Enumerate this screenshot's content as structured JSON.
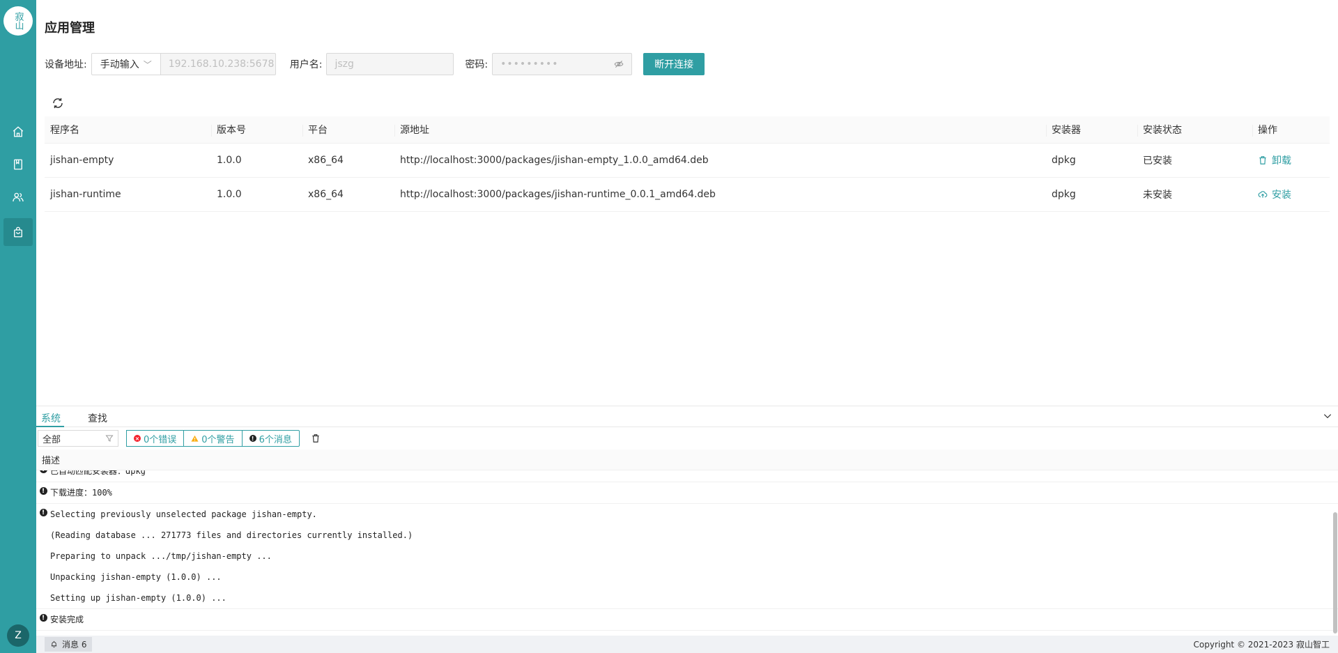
{
  "sidebar": {
    "logo_text": "寂山",
    "avatar": "Z",
    "items": [
      {
        "icon": "home-icon"
      },
      {
        "icon": "book-icon"
      },
      {
        "icon": "users-icon"
      },
      {
        "icon": "bag-icon",
        "active": true
      }
    ]
  },
  "page": {
    "title": "应用管理"
  },
  "connection": {
    "address_label": "设备地址:",
    "mode": "手动输入",
    "address": "192.168.10.238:5678",
    "user_label": "用户名:",
    "user": "jszg",
    "password_label": "密码:",
    "password": "•••••••••",
    "disconnect": "断开连接"
  },
  "table": {
    "headers": [
      "程序名",
      "版本号",
      "平台",
      "源地址",
      "安装器",
      "安装状态",
      "操作"
    ],
    "rows": [
      {
        "name": "jishan-empty",
        "version": "1.0.0",
        "platform": "x86_64",
        "source": "http://localhost:3000/packages/jishan-empty_1.0.0_amd64.deb",
        "installer": "dpkg",
        "status": "已安装",
        "action": "卸载"
      },
      {
        "name": "jishan-runtime",
        "version": "1.0.0",
        "platform": "x86_64",
        "source": "http://localhost:3000/packages/jishan-runtime_0.0.1_amd64.deb",
        "installer": "dpkg",
        "status": "未安装",
        "action": "安装"
      }
    ]
  },
  "panel": {
    "tabs": [
      "系统",
      "查找"
    ],
    "filter": "全部",
    "errors": "0个错误",
    "warnings": "0个警告",
    "messages": "6个消息",
    "desc_header": "描述",
    "logs": [
      {
        "lines": [
          "已自动匹配安装器：dpkg"
        ]
      },
      {
        "lines": [
          "下载进度：100%"
        ]
      },
      {
        "lines": [
          "Selecting previously unselected package jishan-empty.",
          "(Reading database ... 271773 files and directories currently installed.)",
          "Preparing to unpack .../tmp/jishan-empty ...",
          "Unpacking jishan-empty (1.0.0) ...",
          "Setting up jishan-empty (1.0.0) ..."
        ]
      },
      {
        "lines": [
          "安装完成"
        ]
      }
    ]
  },
  "statusbar": {
    "messages": "消息 6",
    "copyright": "Copyright © 2021-2023 寂山智工"
  },
  "colors": {
    "accent": "#2f9ea3",
    "error": "#f5222d",
    "warning": "#faad14"
  }
}
